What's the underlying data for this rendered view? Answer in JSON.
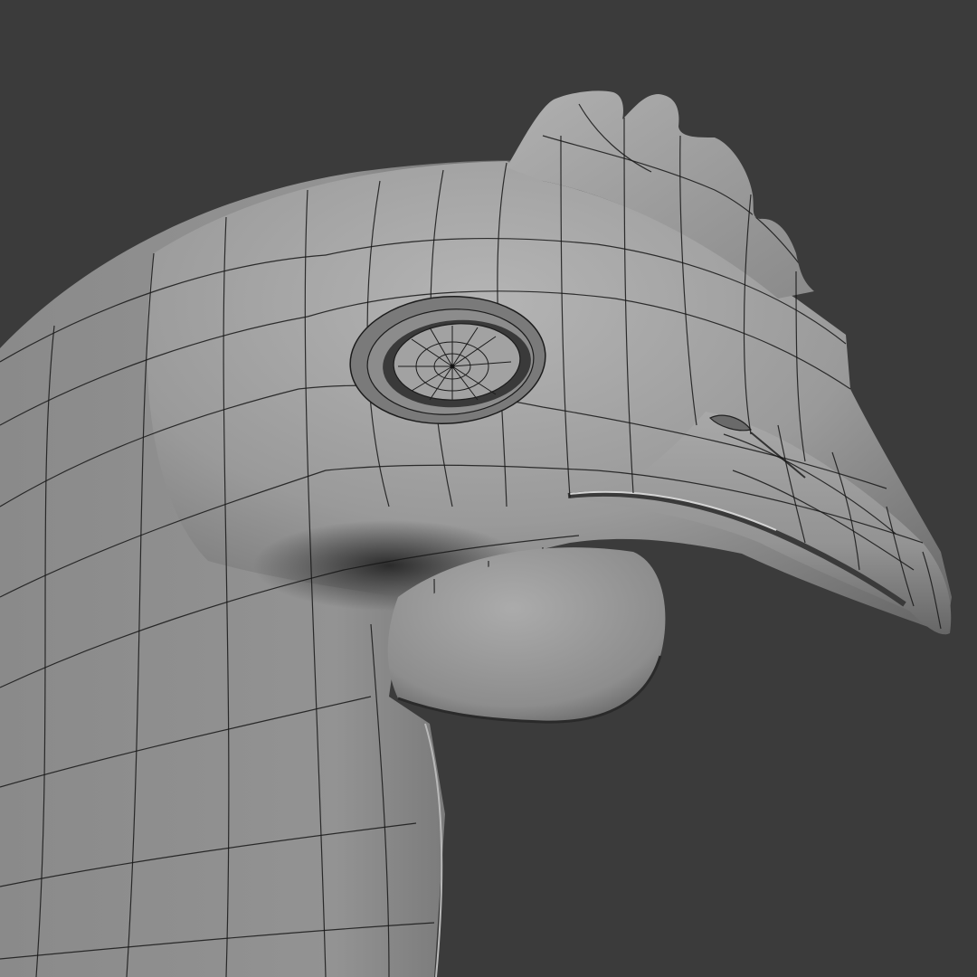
{
  "viewport": {
    "background_color": "#3b3b3b",
    "subject": "3d-bird-head-wireframe"
  },
  "colors": {
    "surface_light": "#a9a9a9",
    "surface_mid": "#8e8e8e",
    "surface_dark": "#5c5c5c",
    "wire": "#1a1a1a",
    "shadow": "#1e1e1e"
  }
}
